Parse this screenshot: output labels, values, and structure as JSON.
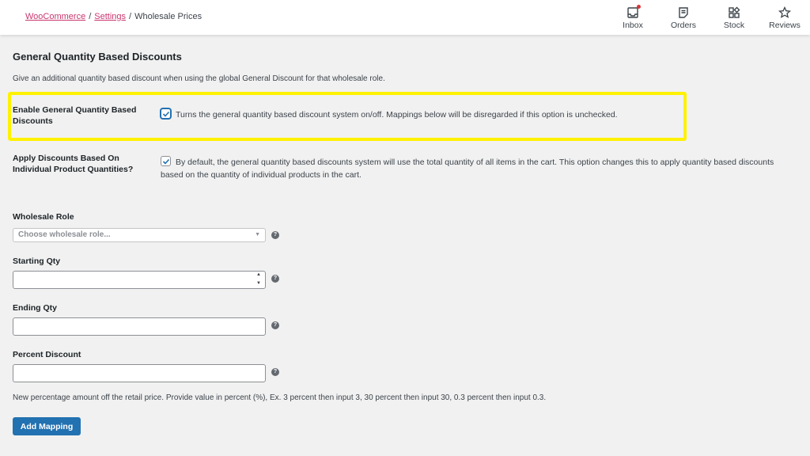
{
  "breadcrumb": {
    "items": [
      {
        "label": "WooCommerce",
        "link": true
      },
      {
        "label": "Settings",
        "link": true
      },
      {
        "label": "Wholesale Prices",
        "link": false
      }
    ],
    "separator": "/"
  },
  "topnav": {
    "items": [
      {
        "label": "Inbox",
        "icon": "inbox-icon",
        "has_notification": true
      },
      {
        "label": "Orders",
        "icon": "orders-icon"
      },
      {
        "label": "Stock",
        "icon": "stock-icon"
      },
      {
        "label": "Reviews",
        "icon": "star-icon"
      }
    ]
  },
  "section": {
    "title": "General Quantity Based Discounts",
    "description": "Give an additional quantity based discount when using the global General Discount for that wholesale role."
  },
  "settings": {
    "enable": {
      "label": "Enable General Quantity Based Discounts",
      "checked": true,
      "description": "Turns the general quantity based discount system on/off. Mappings below will be disregarded if this option is unchecked."
    },
    "individual": {
      "label": "Apply Discounts Based On Individual Product Quantities?",
      "checked": true,
      "description": "By default, the general quantity based discounts system will use the total quantity of all items in the cart. This option changes this to apply quantity based discounts based on the quantity of individual products in the cart."
    }
  },
  "form": {
    "wholesale_role": {
      "label": "Wholesale Role",
      "placeholder": "Choose wholesale role...",
      "value": ""
    },
    "starting_qty": {
      "label": "Starting Qty",
      "value": ""
    },
    "ending_qty": {
      "label": "Ending Qty",
      "value": ""
    },
    "percent_discount": {
      "label": "Percent Discount",
      "value": ""
    },
    "help_glyph": "?",
    "note": "New percentage amount off the retail price. Provide value in percent (%), Ex. 3 percent then input 3, 30 percent then input 30, 0.3 percent then input 0.3.",
    "add_button": "Add Mapping"
  },
  "colors": {
    "link": "#c9356e",
    "primary": "#2271b1",
    "highlight": "#fff200",
    "notification": "#d63638"
  }
}
